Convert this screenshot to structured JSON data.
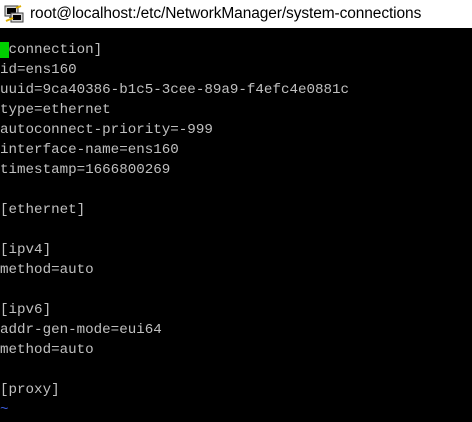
{
  "window": {
    "title": "root@localhost:/etc/NetworkManager/system-connections"
  },
  "terminal": {
    "cursor_char": "[",
    "first_line_rest": "connection]",
    "lines": [
      "id=ens160",
      "uuid=9ca40386-b1c5-3cee-89a9-f4efc4e0881c",
      "type=ethernet",
      "autoconnect-priority=-999",
      "interface-name=ens160",
      "timestamp=1666800269",
      "",
      "[ethernet]",
      "",
      "[ipv4]",
      "method=auto",
      "",
      "[ipv6]",
      "addr-gen-mode=eui64",
      "method=auto",
      "",
      "[proxy]"
    ],
    "empty_marker": "~"
  }
}
